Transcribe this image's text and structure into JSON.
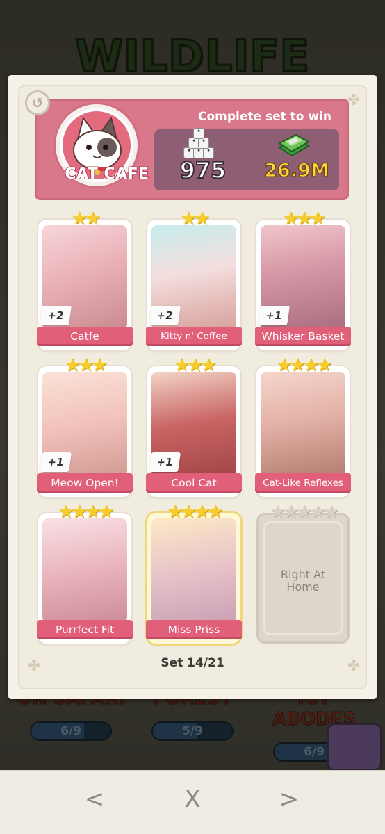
{
  "background": {
    "title": "WILDLIFE",
    "sets": [
      {
        "name": "ON SAFARI",
        "progress": "6/9",
        "fraction": 0.667
      },
      {
        "name": "FOREST",
        "progress": "5/9",
        "fraction": 0.556
      },
      {
        "name": "ICY ABODES",
        "progress": "6/9",
        "fraction": 0.667
      }
    ]
  },
  "header": {
    "prompt": "Complete set to win",
    "set_name": "CAT CAFE",
    "dice_reward": "975",
    "cash_reward": "26.9M",
    "accent_color": "#d9788a"
  },
  "cards": [
    {
      "name": "Catfe",
      "stars": 2,
      "count": "+2",
      "gold": false
    },
    {
      "name": "Kitty n' Coffee",
      "stars": 2,
      "count": "+2",
      "gold": false
    },
    {
      "name": "Whisker Basket",
      "stars": 3,
      "count": "+1",
      "gold": false
    },
    {
      "name": "Meow Open!",
      "stars": 3,
      "count": "+1",
      "gold": false
    },
    {
      "name": "Cool Cat",
      "stars": 3,
      "count": "+1",
      "gold": false
    },
    {
      "name": "Cat-Like Reflexes",
      "stars": 4,
      "count": "",
      "gold": false
    },
    {
      "name": "Purrfect Fit",
      "stars": 4,
      "count": "",
      "gold": false
    },
    {
      "name": "Miss Priss",
      "stars": 4,
      "count": "",
      "gold": true
    },
    {
      "name": "Right At Home",
      "stars": 5,
      "count": "",
      "locked": true
    }
  ],
  "footer": {
    "set_progress": "Set 14/21"
  },
  "nav": {
    "prev": "<",
    "close": "X",
    "next": ">"
  }
}
